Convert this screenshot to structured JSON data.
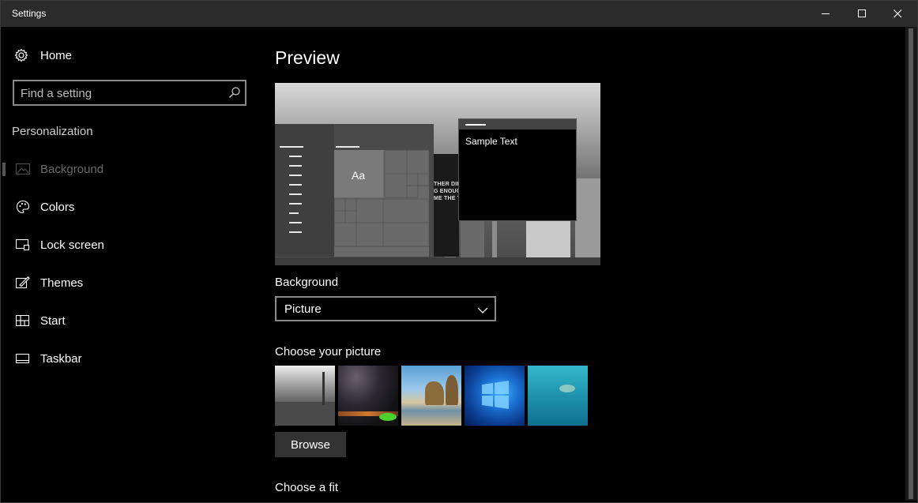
{
  "window": {
    "title": "Settings",
    "controls": {
      "minimize_icon": "minimize-icon",
      "maximize_icon": "maximize-icon",
      "close_icon": "close-icon"
    }
  },
  "sidebar": {
    "home_label": "Home",
    "home_icon": "gear-icon",
    "search": {
      "placeholder": "Find a setting",
      "value": "",
      "icon": "search-icon"
    },
    "section_title": "Personalization",
    "items": [
      {
        "label": "Background",
        "icon": "picture-icon",
        "active": true
      },
      {
        "label": "Colors",
        "icon": "palette-icon",
        "active": false
      },
      {
        "label": "Lock screen",
        "icon": "lock-screen-icon",
        "active": false
      },
      {
        "label": "Themes",
        "icon": "brush-icon",
        "active": false
      },
      {
        "label": "Start",
        "icon": "start-grid-icon",
        "active": false
      },
      {
        "label": "Taskbar",
        "icon": "taskbar-icon",
        "active": false
      }
    ]
  },
  "main": {
    "preview_heading": "Preview",
    "preview": {
      "sample_text": "Sample Text",
      "tile_label": "Aa",
      "wallpaper_text": [
        "THER DIE",
        "G ENOUG",
        "ME THE T"
      ]
    },
    "background_label": "Background",
    "background_select": {
      "value": "Picture",
      "icon": "chevron-down-icon"
    },
    "choose_picture_label": "Choose your picture",
    "pictures": [
      {
        "name": "city-skyline-thumbnail"
      },
      {
        "name": "night-sky-thumbnail"
      },
      {
        "name": "beach-rocks-thumbnail"
      },
      {
        "name": "windows-logo-thumbnail"
      },
      {
        "name": "underwater-thumbnail"
      }
    ],
    "browse_label": "Browse",
    "choose_fit_label": "Choose a fit"
  },
  "colors": {
    "window_bg": "#000000",
    "titlebar_bg": "#2b2b2b",
    "disabled_text": "#6a6a6a",
    "button_bg": "#333333"
  }
}
